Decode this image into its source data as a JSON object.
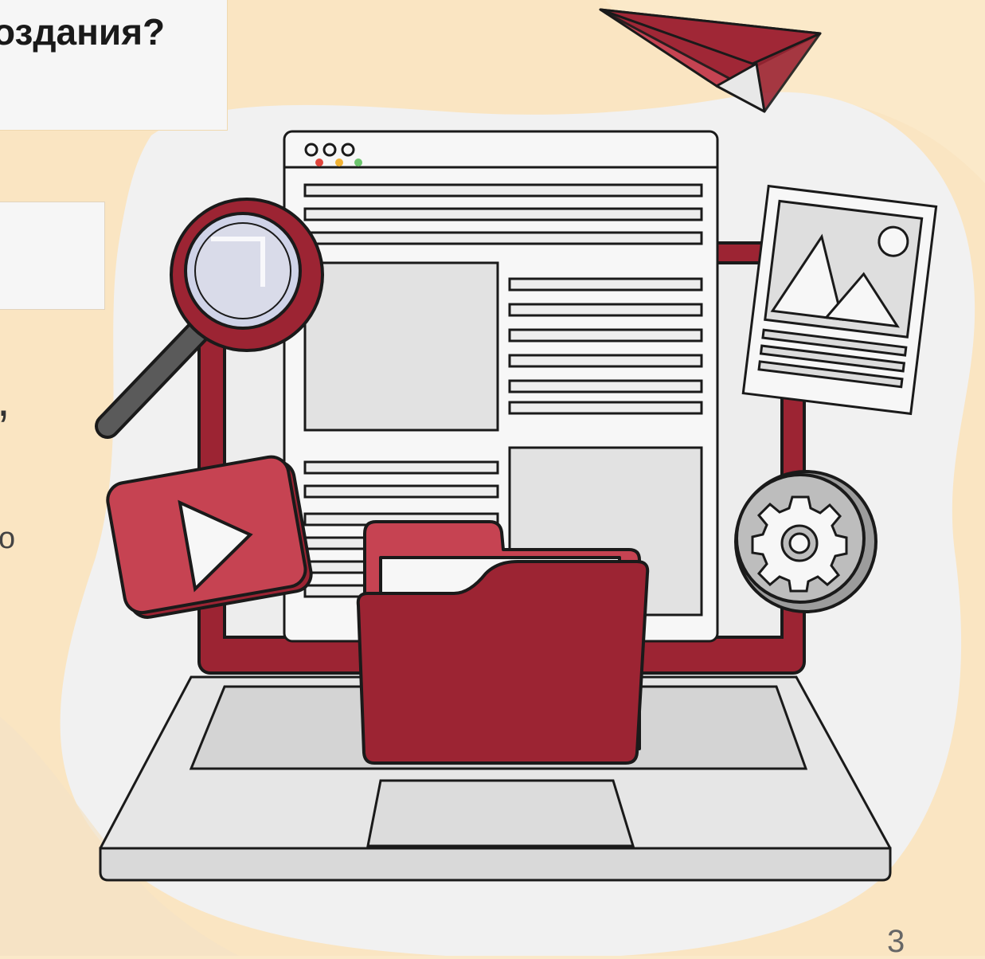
{
  "slide": {
    "title_fragment": "оздания?",
    "left_text_fragments": {
      "comma": ",",
      "letter": "о"
    },
    "page_number": "3"
  },
  "colors": {
    "background_warm": "#fbe9c9",
    "blob_gray": "#f1f1f1",
    "accent_red": "#9c2433",
    "accent_red_light": "#c64352",
    "outline": "#1a1a1a",
    "panel_gray": "#e2e2e2"
  },
  "illustration": {
    "elements": [
      "paper-plane-icon",
      "browser-window",
      "magnifier-icon",
      "image-card-icon",
      "video-play-icon",
      "folder-icon",
      "gear-icon",
      "laptop"
    ]
  }
}
